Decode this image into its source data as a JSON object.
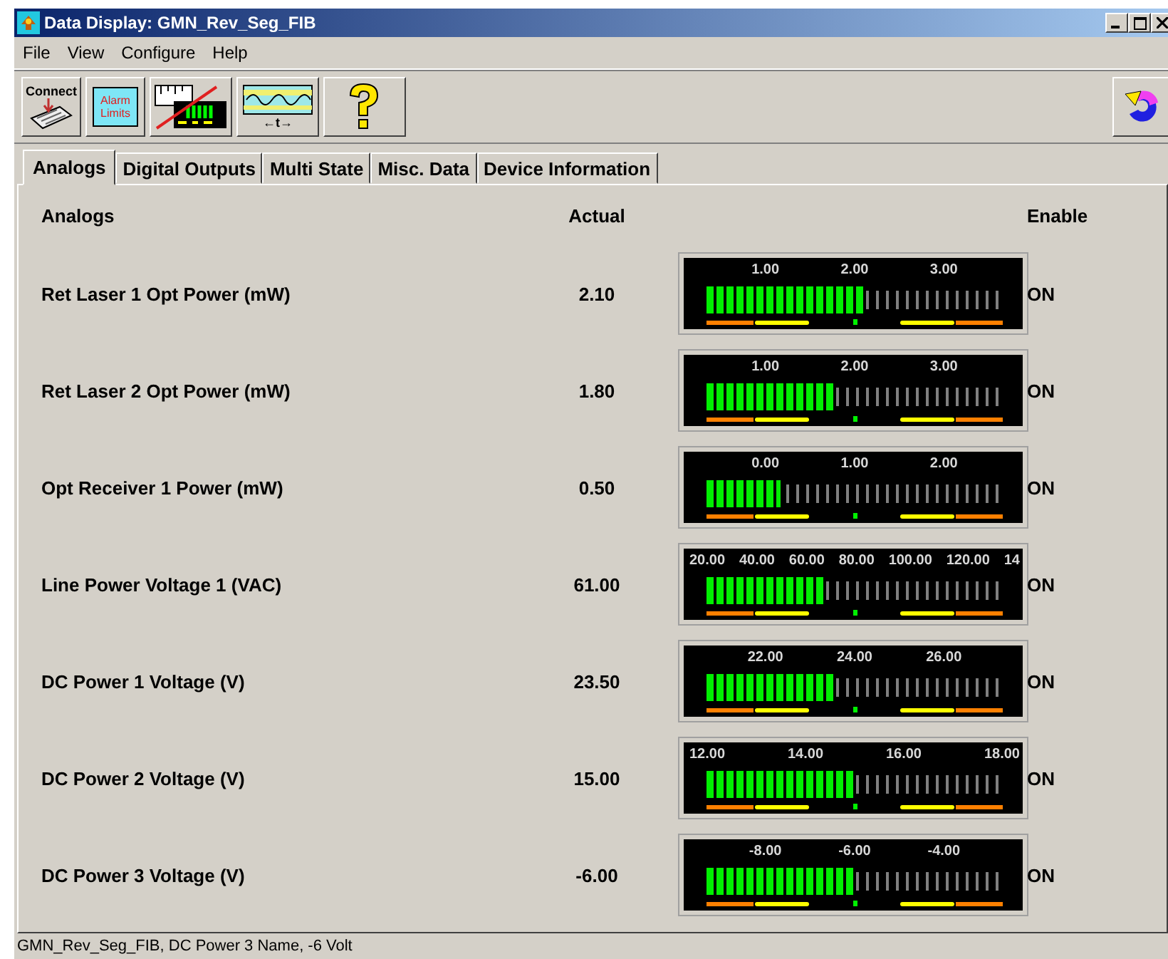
{
  "window": {
    "title": "Data Display: GMN_Rev_Seg_FIB"
  },
  "menu": [
    "File",
    "View",
    "Configure",
    "Help"
  ],
  "toolbar": [
    {
      "kind": "connect",
      "label": "Connect"
    },
    {
      "kind": "alarm",
      "label": "Alarm Limits"
    },
    {
      "kind": "meter-off"
    },
    {
      "kind": "trend",
      "label": "←t→"
    },
    {
      "kind": "help"
    }
  ],
  "toolbar_right": [
    {
      "kind": "refresh"
    }
  ],
  "tabs": [
    {
      "label": "Analogs",
      "selected": true
    },
    {
      "label": "Digital Outputs",
      "selected": false
    },
    {
      "label": "Multi State",
      "selected": false
    },
    {
      "label": "Misc. Data",
      "selected": false
    },
    {
      "label": "Device Information",
      "selected": false
    }
  ],
  "table": {
    "columns": [
      "Analogs",
      "Actual",
      "Enable"
    ],
    "rows": [
      {
        "name": "Ret Laser 1 Opt Power (mW)",
        "actual": "2.10",
        "scale": [
          "1.00",
          "2.00",
          "3.00"
        ],
        "level": 0.53,
        "enable": "ON"
      },
      {
        "name": "Ret Laser 2 Opt Power (mW)",
        "actual": "1.80",
        "scale": [
          "1.00",
          "2.00",
          "3.00"
        ],
        "level": 0.43,
        "enable": "ON"
      },
      {
        "name": "Opt Receiver 1 Power (mW)",
        "actual": "0.50",
        "scale": [
          "0.00",
          "1.00",
          "2.00"
        ],
        "level": 0.25,
        "enable": "ON"
      },
      {
        "name": "Line Power Voltage 1 (VAC)",
        "actual": "61.00",
        "scale": [
          "20.00",
          "40.00",
          "60.00",
          "80.00",
          "100.00",
          "120.00",
          "14"
        ],
        "level": 0.4,
        "enable": "ON"
      },
      {
        "name": "DC Power 1 Voltage (V)",
        "actual": "23.50",
        "scale": [
          "22.00",
          "24.00",
          "26.00"
        ],
        "level": 0.43,
        "enable": "ON"
      },
      {
        "name": "DC Power 2 Voltage (V)",
        "actual": "15.00",
        "scale": [
          "12.00",
          "14.00",
          "16.00",
          "18.00"
        ],
        "level": 0.5,
        "enable": "ON"
      },
      {
        "name": "DC Power 3 Voltage (V)",
        "actual": "-6.00",
        "scale": [
          "-8.00",
          "-6.00",
          "-4.00"
        ],
        "level": 0.5,
        "enable": "ON"
      }
    ]
  },
  "status_bar": "GMN_Rev_Seg_FIB, DC Power 3 Name, -6 Volt"
}
